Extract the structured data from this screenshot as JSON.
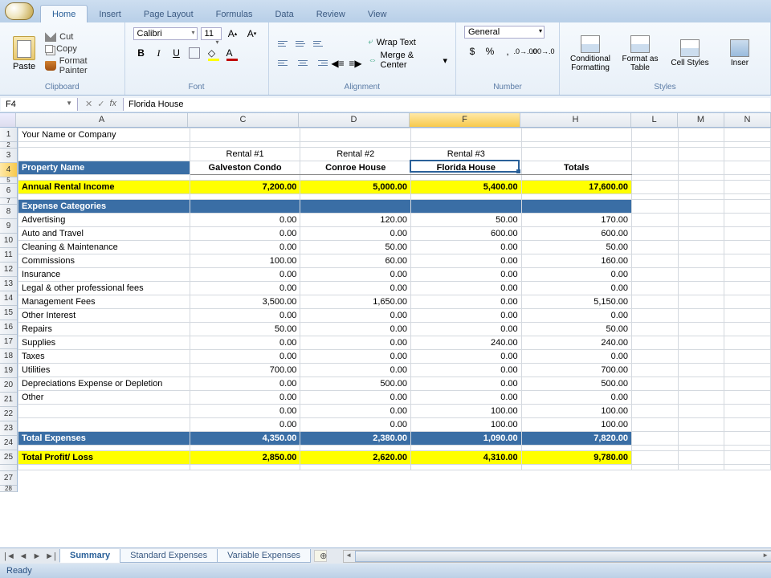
{
  "ribbon": {
    "tabs": [
      "Home",
      "Insert",
      "Page Layout",
      "Formulas",
      "Data",
      "Review",
      "View"
    ],
    "active_tab": "Home",
    "clipboard": {
      "title": "Clipboard",
      "paste": "Paste",
      "cut": "Cut",
      "copy": "Copy",
      "format_painter": "Format Painter"
    },
    "font": {
      "title": "Font",
      "name": "Calibri",
      "size": "11"
    },
    "alignment": {
      "title": "Alignment",
      "wrap": "Wrap Text",
      "merge": "Merge & Center"
    },
    "number": {
      "title": "Number",
      "format": "General"
    },
    "styles": {
      "title": "Styles",
      "conditional": "Conditional Formatting",
      "format_table": "Format as Table",
      "cell_styles": "Cell Styles",
      "insert": "Inser"
    }
  },
  "formula_bar": {
    "cell_ref": "F4",
    "formula": "Florida House"
  },
  "columns": [
    "A",
    "C",
    "D",
    "F",
    "H",
    "L",
    "M",
    "N"
  ],
  "active_col": "F",
  "active_row": 4,
  "sheet": {
    "title_row": "Your Name or Company",
    "rental_labels": [
      "Rental #1",
      "Rental #2",
      "Rental #3"
    ],
    "property_header": "Property Name",
    "totals_header": "Totals",
    "properties": [
      "Galveston Condo",
      "Conroe House",
      "Florida House"
    ],
    "income_label": "Annual Rental Income",
    "income": [
      "7,200.00",
      "5,000.00",
      "5,400.00",
      "17,600.00"
    ],
    "expense_header": "Expense Categories",
    "expenses": [
      {
        "label": "Advertising",
        "v": [
          "0.00",
          "120.00",
          "50.00",
          "170.00"
        ]
      },
      {
        "label": "Auto and Travel",
        "v": [
          "0.00",
          "0.00",
          "600.00",
          "600.00"
        ]
      },
      {
        "label": "Cleaning & Maintenance",
        "v": [
          "0.00",
          "50.00",
          "0.00",
          "50.00"
        ]
      },
      {
        "label": "Commissions",
        "v": [
          "100.00",
          "60.00",
          "0.00",
          "160.00"
        ]
      },
      {
        "label": "Insurance",
        "v": [
          "0.00",
          "0.00",
          "0.00",
          "0.00"
        ]
      },
      {
        "label": "Legal & other professional fees",
        "v": [
          "0.00",
          "0.00",
          "0.00",
          "0.00"
        ]
      },
      {
        "label": "Management Fees",
        "v": [
          "3,500.00",
          "1,650.00",
          "0.00",
          "5,150.00"
        ]
      },
      {
        "label": "Other Interest",
        "v": [
          "0.00",
          "0.00",
          "0.00",
          "0.00"
        ]
      },
      {
        "label": "Repairs",
        "v": [
          "50.00",
          "0.00",
          "0.00",
          "50.00"
        ]
      },
      {
        "label": "Supplies",
        "v": [
          "0.00",
          "0.00",
          "240.00",
          "240.00"
        ]
      },
      {
        "label": "Taxes",
        "v": [
          "0.00",
          "0.00",
          "0.00",
          "0.00"
        ]
      },
      {
        "label": "Utilities",
        "v": [
          "700.00",
          "0.00",
          "0.00",
          "700.00"
        ]
      },
      {
        "label": "Depreciations Expense or Depletion",
        "v": [
          "0.00",
          "500.00",
          "0.00",
          "500.00"
        ]
      },
      {
        "label": "Other",
        "v": [
          "0.00",
          "0.00",
          "0.00",
          "0.00"
        ]
      },
      {
        "label": "",
        "v": [
          "0.00",
          "0.00",
          "100.00",
          "100.00"
        ]
      },
      {
        "label": "",
        "v": [
          "0.00",
          "0.00",
          "100.00",
          "100.00"
        ]
      }
    ],
    "total_exp_label": "Total Expenses",
    "total_exp": [
      "4,350.00",
      "2,380.00",
      "1,090.00",
      "7,820.00"
    ],
    "profit_label": "Total Profit/ Loss",
    "profit": [
      "2,850.00",
      "2,620.00",
      "4,310.00",
      "9,780.00"
    ]
  },
  "sheet_tabs": {
    "tabs": [
      "Summary",
      "Standard Expenses",
      "Variable Expenses"
    ],
    "active": "Summary"
  },
  "status": "Ready",
  "row_numbers": [
    1,
    2,
    3,
    4,
    5,
    6,
    7,
    8,
    9,
    10,
    11,
    12,
    13,
    14,
    15,
    16,
    17,
    18,
    19,
    20,
    21,
    22,
    23,
    24,
    25,
    "",
    27,
    28
  ]
}
